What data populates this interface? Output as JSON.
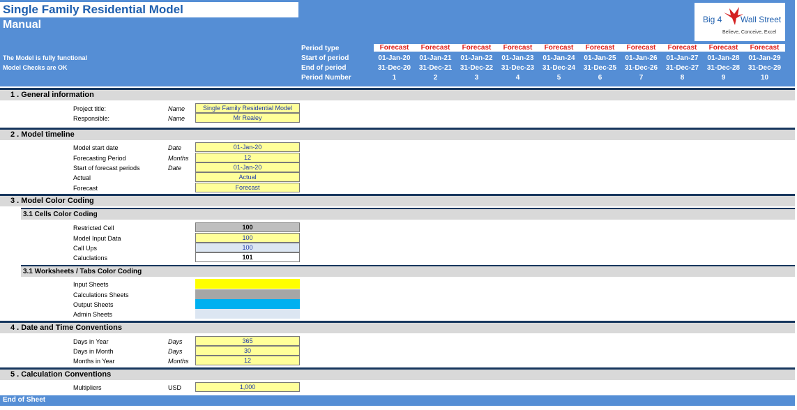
{
  "title": "Single Family Residential Model",
  "subtitle": "Manual",
  "status_lines": [
    "The Model is fully functional",
    "Model Checks are OK"
  ],
  "logo": {
    "text": "Big 4",
    "text2": "Wall Street",
    "tagline": "Believe, Conceive, Excel",
    "icon": "eagle-icon"
  },
  "timeline_labels": {
    "period_type": "Period type",
    "start": "Start of period",
    "end": "End of period",
    "number": "Period Number"
  },
  "periods": [
    {
      "type": "Forecast",
      "start": "01-Jan-20",
      "end": "31-Dec-20",
      "num": "1"
    },
    {
      "type": "Forecast",
      "start": "01-Jan-21",
      "end": "31-Dec-21",
      "num": "2"
    },
    {
      "type": "Forecast",
      "start": "01-Jan-22",
      "end": "31-Dec-22",
      "num": "3"
    },
    {
      "type": "Forecast",
      "start": "01-Jan-23",
      "end": "31-Dec-23",
      "num": "4"
    },
    {
      "type": "Forecast",
      "start": "01-Jan-24",
      "end": "31-Dec-24",
      "num": "5"
    },
    {
      "type": "Forecast",
      "start": "01-Jan-25",
      "end": "31-Dec-25",
      "num": "6"
    },
    {
      "type": "Forecast",
      "start": "01-Jan-26",
      "end": "31-Dec-26",
      "num": "7"
    },
    {
      "type": "Forecast",
      "start": "01-Jan-27",
      "end": "31-Dec-27",
      "num": "8"
    },
    {
      "type": "Forecast",
      "start": "01-Jan-28",
      "end": "31-Dec-28",
      "num": "9"
    },
    {
      "type": "Forecast",
      "start": "01-Jan-29",
      "end": "31-Dec-29",
      "num": "10"
    }
  ],
  "sections": {
    "s1": "1 . General information",
    "s2": "2 . Model timeline",
    "s3": "3 . Model Color Coding",
    "s3a": "3.1 Cells Color Coding",
    "s3b": "3.1 Worksheets / Tabs Color Coding",
    "s4": "4 . Date and Time Conventions",
    "s5": "5 . Calculation Conventions"
  },
  "general": {
    "project_label": "Project title:",
    "project_unit": "Name",
    "project_value": "Single Family Residential Model",
    "resp_label": "Responsible:",
    "resp_unit": "Name",
    "resp_value": "Mr Realey"
  },
  "timeline": [
    {
      "label": "Model start date",
      "unit": "Date",
      "value": "01-Jan-20"
    },
    {
      "label": "Forecasting Period",
      "unit": "Months",
      "value": "12"
    },
    {
      "label": "Start of forecast periods",
      "unit": "Date",
      "value": "01-Jan-20"
    },
    {
      "label": "Actual",
      "unit": "",
      "value": "Actual"
    },
    {
      "label": "Forecast",
      "unit": "",
      "value": "Forecast"
    }
  ],
  "cells_coding": [
    {
      "label": "Restricted Cell",
      "value": "100"
    },
    {
      "label": "Model Input Data",
      "value": "100"
    },
    {
      "label": "Call Ups",
      "value": "100"
    },
    {
      "label": "Caluclations",
      "value": "101"
    }
  ],
  "tabs_coding": [
    {
      "label": "Input Sheets",
      "color": "#ffff00"
    },
    {
      "label": "Calculations Sheets",
      "color": "#a6a6a6"
    },
    {
      "label": "Output Sheets",
      "color": "#00b0f0"
    },
    {
      "label": "Admin Sheets",
      "color": "#dce6f2"
    }
  ],
  "date_conv": [
    {
      "label": "Days in Year",
      "unit": "Days",
      "value": "365"
    },
    {
      "label": "Days in Month",
      "unit": "Days",
      "value": "30"
    },
    {
      "label": "Months in Year",
      "unit": "Months",
      "value": "12"
    }
  ],
  "calc_conv": {
    "label": "Multipliers",
    "unit": "USD",
    "value": "1,000"
  },
  "footer": "End of Sheet"
}
